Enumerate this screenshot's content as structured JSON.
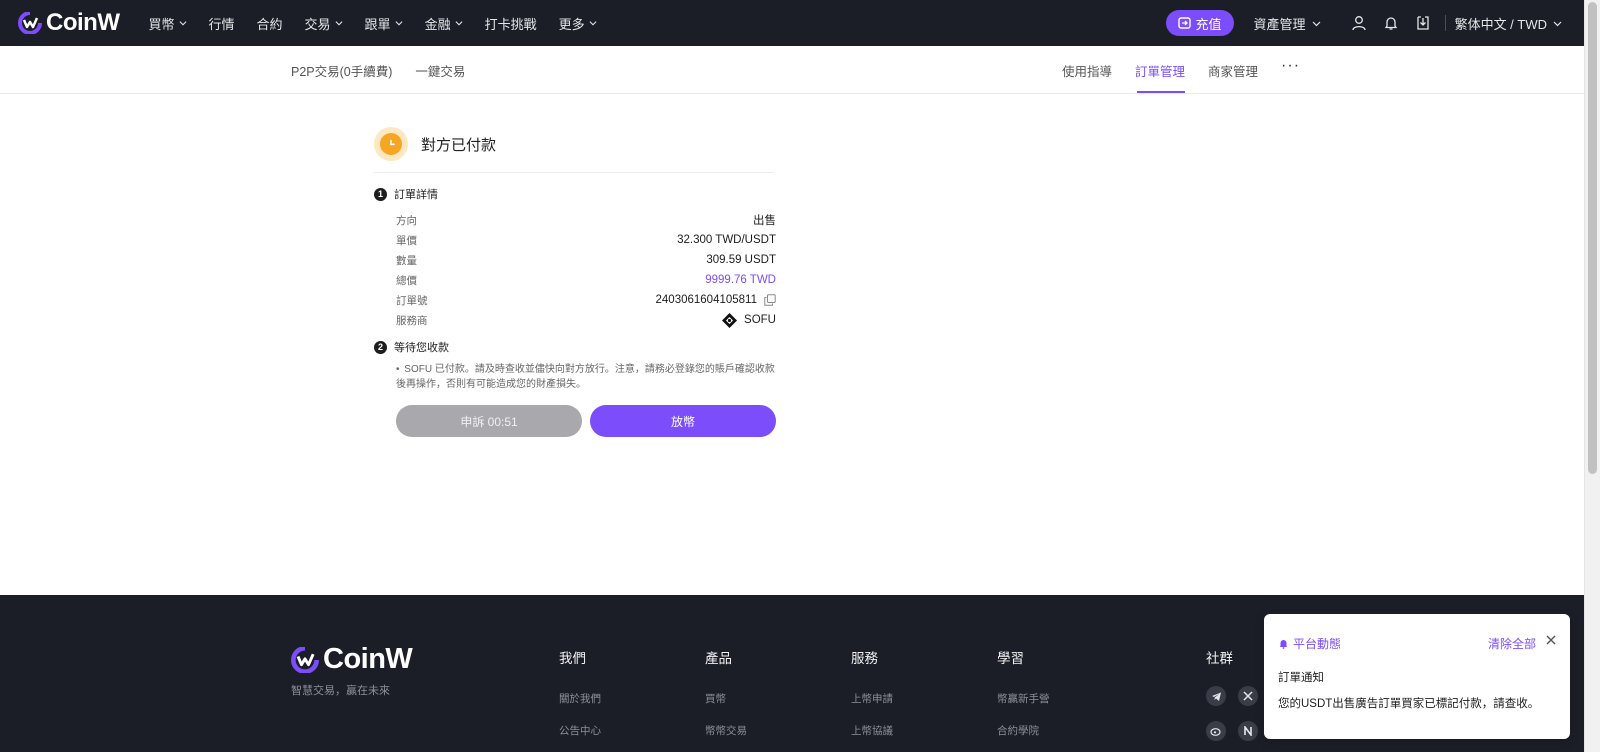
{
  "brand": {
    "name": "CoinW",
    "accent": "#7b4dfb",
    "nav_bg": "#1b1e27"
  },
  "topnav": {
    "items": [
      {
        "label": "買幣",
        "has_dropdown": true
      },
      {
        "label": "行情",
        "has_dropdown": false
      },
      {
        "label": "合約",
        "has_dropdown": false
      },
      {
        "label": "交易",
        "has_dropdown": true
      },
      {
        "label": "跟單",
        "has_dropdown": true
      },
      {
        "label": "金融",
        "has_dropdown": true
      },
      {
        "label": "打卡挑戰",
        "has_dropdown": false
      },
      {
        "label": "更多",
        "has_dropdown": true
      }
    ],
    "deposit_label": "充值",
    "asset_label": "資產管理",
    "lang_label": "繁体中文 / TWD"
  },
  "subnav": {
    "left": [
      "P2P交易(0手續費)",
      "一鍵交易"
    ],
    "right": [
      "使用指導",
      "訂單管理",
      "商家管理"
    ],
    "active": "訂單管理",
    "more": "···"
  },
  "order": {
    "status": "對方已付款",
    "step1": {
      "num": "1",
      "title": "訂單詳情"
    },
    "details": {
      "direction_label": "方向",
      "direction_value": "出售",
      "price_label": "單價",
      "price_value": "32.300 TWD/USDT",
      "qty_label": "數量",
      "qty_value": "309.59 USDT",
      "total_label": "總價",
      "total_value": "9999.76 TWD",
      "order_no_label": "訂單號",
      "order_no_value": "2403061604105811",
      "provider_label": "服務商",
      "provider_value": "SOFU"
    },
    "step2": {
      "num": "2",
      "title": "等待您收款"
    },
    "notice_bullet": "•",
    "notice": "SOFU 已付款。請及時查收並儘快向對方放行。注意，請務必登錄您的賬戶確認收款後再操作，否則有可能造成您的財產損失。",
    "appeal_label": "申訴 00:51",
    "release_label": "放幣"
  },
  "footer": {
    "logo_text": "CoinW",
    "slogan": "智慧交易，贏在未來",
    "columns": [
      {
        "title": "我們",
        "links": [
          "關於我們",
          "公告中心"
        ]
      },
      {
        "title": "產品",
        "links": [
          "買幣",
          "幣幣交易"
        ]
      },
      {
        "title": "服務",
        "links": [
          "上幣申請",
          "上幣協議"
        ]
      },
      {
        "title": "學習",
        "links": [
          "幣贏新手營",
          "合約學院"
        ]
      }
    ],
    "social_title": "社群",
    "social_icons": [
      "telegram-icon",
      "x-icon",
      "weibo-icon",
      "n-icon"
    ]
  },
  "toast": {
    "header": "平台動態",
    "clear_label": "清除全部",
    "title": "訂單通知",
    "body": "您的USDT出售廣告訂單買家已標記付款，請查收。"
  }
}
